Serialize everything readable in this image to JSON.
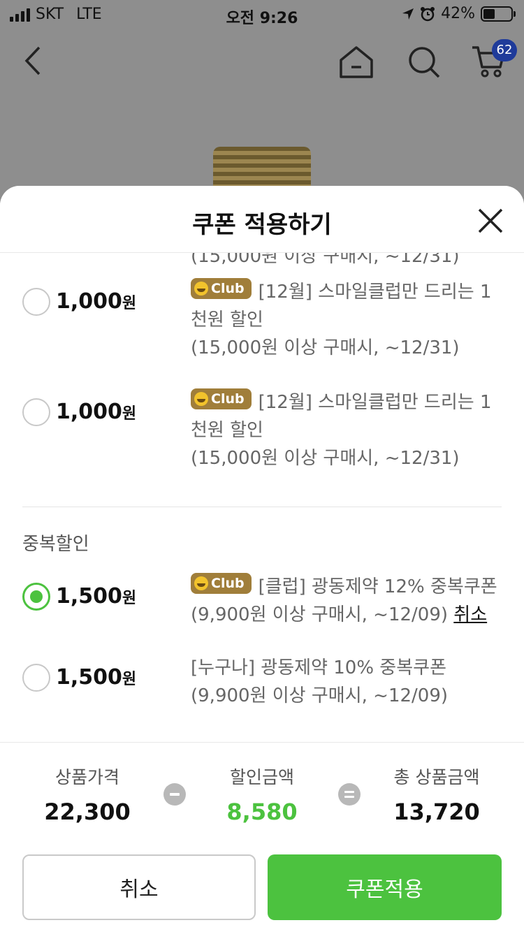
{
  "statusbar": {
    "carrier": "SKT",
    "network": "LTE",
    "time": "오전 9:26",
    "battery": "42%",
    "battery_level": 0.42
  },
  "nav": {
    "cart_count": "62",
    "icons": [
      "back-icon",
      "home-icon",
      "search-icon",
      "cart-icon"
    ]
  },
  "sheet": {
    "title": "쿠폰 적용하기",
    "cutoff_text": "(15,000원 이상 구매시, ~12/31)",
    "coupons": [
      {
        "amount": "1,000",
        "unit": "원",
        "badge": "Club",
        "title": "[12월] 스마일클럽만 드리는 1천원 할인",
        "condition": "(15,000원 이상 구매시, ~12/31)",
        "selected": false
      },
      {
        "amount": "1,000",
        "unit": "원",
        "badge": "Club",
        "title": "[12월] 스마일클럽만 드리는 1천원 할인",
        "condition": "(15,000원 이상 구매시, ~12/31)",
        "selected": false
      }
    ],
    "duplicate_section": {
      "title": "중복할인",
      "coupons": [
        {
          "amount": "1,500",
          "unit": "원",
          "badge": "Club",
          "title": "[클럽] 광동제약 12% 중복쿠폰",
          "condition": "(9,900원 이상 구매시, ~12/09)",
          "cancel_link": "취소",
          "selected": true
        },
        {
          "amount": "1,500",
          "unit": "원",
          "badge": "",
          "title": "[누구나] 광동제약 10% 중복쿠폰",
          "condition": "(9,900원 이상 구매시, ~12/09)",
          "selected": false
        }
      ]
    }
  },
  "summary": {
    "price_label": "상품가격",
    "price_value": "22,300",
    "discount_label": "할인금액",
    "discount_value": "8,580",
    "total_label": "총 상품금액",
    "total_value": "13,720"
  },
  "buttons": {
    "cancel": "취소",
    "apply": "쿠폰적용"
  },
  "colors": {
    "accent": "#4cc23f",
    "club_badge": "#a07e3a",
    "cart_badge": "#1f3b9a"
  }
}
